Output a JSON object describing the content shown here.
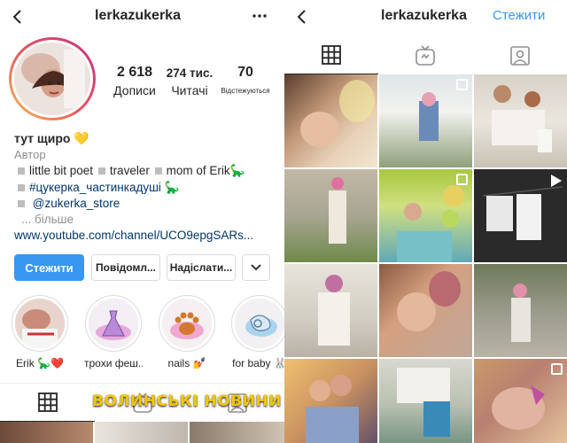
{
  "profile": {
    "username": "lerkazukerka",
    "stats": [
      {
        "value": "2 618",
        "label": "Дописи"
      },
      {
        "value": "274 тис.",
        "label": "Читачі"
      },
      {
        "value": "70",
        "label": "Відстежуються"
      }
    ],
    "name": "тут щиро",
    "name_emoji": "💛",
    "category": "Автор",
    "bio": {
      "line1": [
        "little bit poet",
        "traveler",
        "mom of Erik"
      ],
      "line1_emoji": "🦕",
      "line2_hashtag": "#цукерка_частинкадуші",
      "line2_emoji": "🦕",
      "line3_mention": "@zukerka_store",
      "more": "... більше"
    },
    "website": "www.youtube.com/channel/UCO9epgSARs..."
  },
  "actions": {
    "follow": "Стежити",
    "message": "Повідомл...",
    "email": "Надіслати...",
    "dropdown": "chevron-down-icon"
  },
  "highlights": [
    {
      "label": "Erik 🦕❤️"
    },
    {
      "label": "трохи феш..."
    },
    {
      "label": "nails 💅"
    },
    {
      "label": "for baby 🐰"
    }
  ],
  "right_header": {
    "username": "lerkazukerka",
    "follow": "Стежити"
  },
  "tabs": [
    "grid-icon",
    "igtv-icon",
    "tagged-icon"
  ],
  "watermark": "ВОЛИНСЬКІ НОВИНИ",
  "colors": {
    "accent": "#3897f0",
    "text": "#262626",
    "secondary": "#8e8e8e",
    "link": "#00376b",
    "watermark": "#f2c500"
  }
}
